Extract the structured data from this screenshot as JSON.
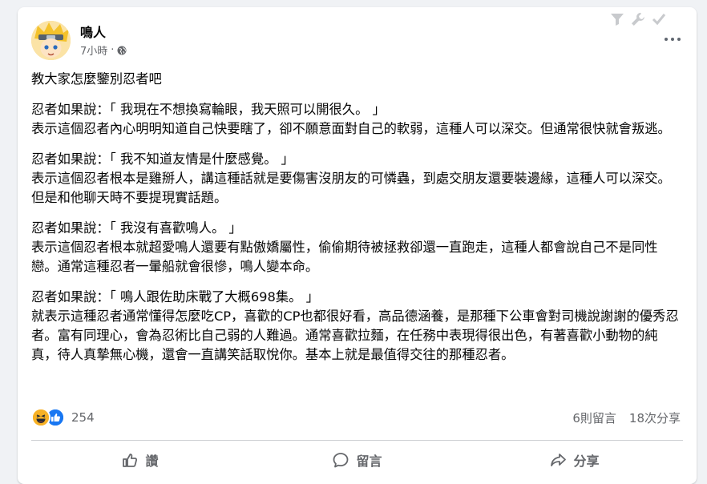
{
  "post": {
    "author": "鳴人",
    "time": "7小時",
    "separator": "·",
    "paragraphs": [
      "教大家怎麼鑒別忍者吧",
      "忍者如果說：「 我現在不想換寫輪眼，我天照可以開很久。 」\n表示這個忍者內心明明知道自己快要瞎了，卻不願意面對自己的軟弱，這種人可以深交。但通常很快就會叛逃。",
      "忍者如果說：「 我不知道友情是什麼感覺。 」\n表示這個忍者根本是雞掰人，講這種話就是要傷害沒朋友的可憐蟲，到處交朋友還要裝邊緣，這種人可以深交。但是和他聊天時不要提現實話題。",
      "忍者如果說：「 我沒有喜歡鳴人。 」\n表示這個忍者根本就超愛鳴人還要有點傲嬌屬性，偷偷期待被拯救卻還一直跑走，這種人都會說自己不是同性戀。通常這種忍者一暈船就會很慘，鳴人變本命。",
      "忍者如果說：「 鳴人跟佐助床戰了大概698集。 」\n就表示這種忍者通常懂得怎麼吃CP，喜歡的CP也都很好看，高品德涵養，是那種下公車會對司機說謝謝的優秀忍者。富有同理心，會為忍術比自己弱的人難過。通常喜歡拉麵，在任務中表現得很出色，有著喜歡小動物的純真，待人真摯無心機，還會一直講笑話取悅你。基本上就是最值得交往的那種忍者。"
    ]
  },
  "reactions": {
    "count": "254",
    "types": [
      "haha-icon",
      "like-icon"
    ]
  },
  "stats": {
    "comments": "6則留言",
    "shares": "18次分享"
  },
  "actions": {
    "like": "讚",
    "comment": "留言",
    "share": "分享"
  },
  "colors": {
    "like_blue": "#1877f2",
    "haha_yellow": "#f7b125",
    "secondary_text": "#65676b"
  }
}
